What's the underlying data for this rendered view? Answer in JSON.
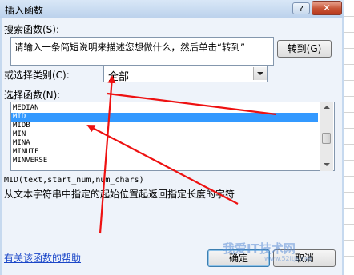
{
  "window": {
    "title": "插入函数",
    "help_glyph": "?",
    "close_glyph": "✕"
  },
  "search": {
    "label": "搜索函数(S):",
    "value": "请输入一条简短说明来描述您想做什么，然后单击“转到”",
    "go_button": "转到(G)"
  },
  "category": {
    "label": "或选择类别(C):",
    "selected": "全部"
  },
  "function_list": {
    "label": "选择函数(N):",
    "items": [
      "MEDIAN",
      "MID",
      "MIDB",
      "MIN",
      "MINA",
      "MINUTE",
      "MINVERSE"
    ],
    "selected_index": 1
  },
  "description": {
    "signature": "MID(text,start_num,num_chars)",
    "text": "从文本字符串中指定的起始位置起返回指定长度的字符"
  },
  "footer": {
    "help_link": "有关该函数的帮助",
    "ok_button": "确定",
    "cancel_button": "取消"
  },
  "watermark": {
    "text": "我爱IT技术网",
    "sub": "www.52itjs.net"
  },
  "colors": {
    "annotation_arrow": "#ee1111",
    "selection": "#3399ff"
  },
  "icons": {
    "dropdown": "chevron-down-icon",
    "scroll_up": "scroll-up-icon",
    "scroll_down": "scroll-down-icon"
  }
}
